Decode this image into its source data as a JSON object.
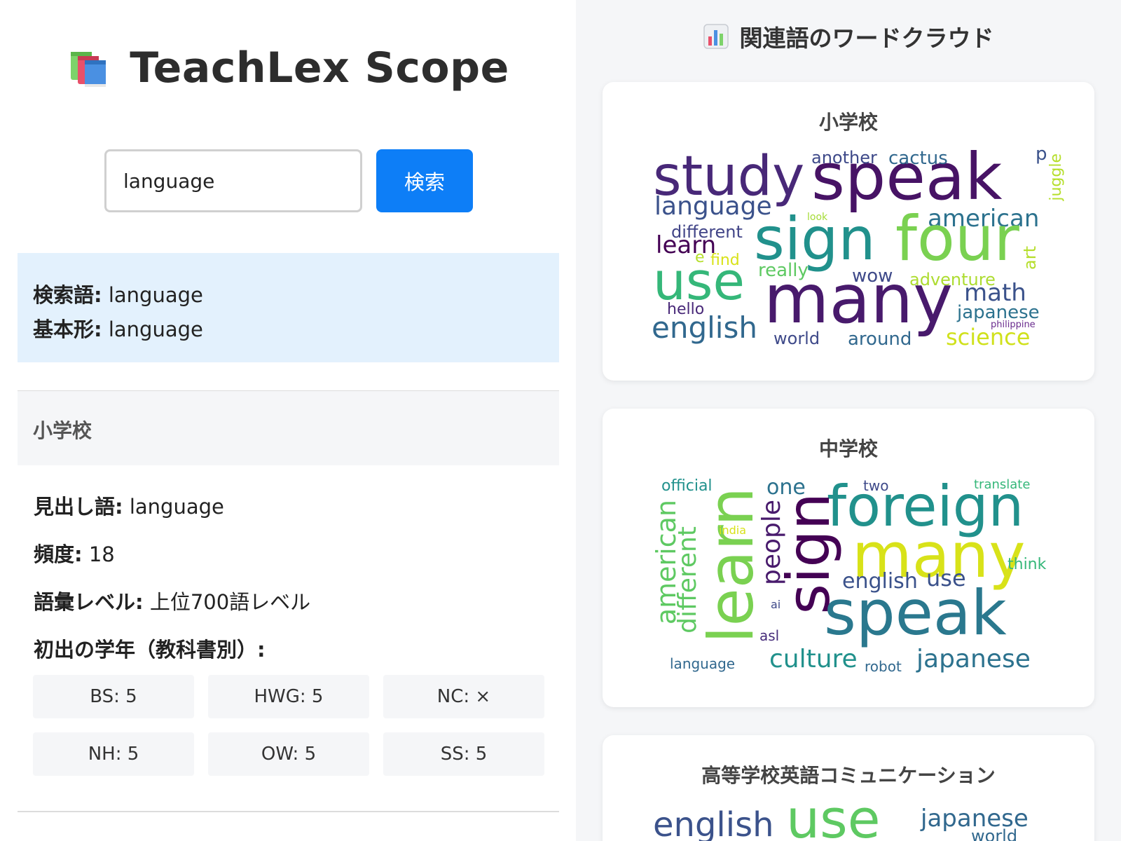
{
  "app": {
    "title": "TeachLex Scope",
    "logo_icon": "books-icon"
  },
  "search": {
    "value": "language",
    "button_label": "検索",
    "button_color": "#0d7ef7"
  },
  "result": {
    "query_label": "検索語:",
    "query_value": " language",
    "base_label": "基本形:",
    "base_value": " language"
  },
  "section": {
    "title": "小学校",
    "headword_label": "見出し語:",
    "headword_value": " language",
    "freq_label": "頻度:",
    "freq_value": " 18",
    "level_label": "語彙レベル:",
    "level_value": " 上位700語レベル",
    "first_grade_label": "初出の学年（教科書別）:",
    "grades": [
      "BS: 5",
      "HWG: 5",
      "NC: ×",
      "NH: 5",
      "OW: 5",
      "SS: 5"
    ]
  },
  "wordcloud": {
    "heading": "関連語のワードクラウド",
    "heading_icon": "bar-chart-icon",
    "cards": [
      {
        "title": "小学校",
        "words": [
          "study",
          "speak",
          "another",
          "cactus",
          "p",
          "juggle",
          "language",
          "american",
          "look",
          "different",
          "learn",
          "sign",
          "four",
          "e",
          "find",
          "art",
          "really",
          "wow",
          "adventure",
          "use",
          "math",
          "hello",
          "many",
          "japanese",
          "english",
          "philippine",
          "world",
          "around",
          "science"
        ]
      },
      {
        "title": "中学校",
        "words": [
          "official",
          "one",
          "two",
          "translate",
          "foreign",
          "american",
          "learn",
          "india",
          "people",
          "sign",
          "many",
          "different",
          "think",
          "english",
          "use",
          "ai",
          "speak",
          "asl",
          "language",
          "culture",
          "robot",
          "japanese"
        ]
      },
      {
        "title": "高等学校英語コミュニケーション",
        "words": [
          "english",
          "use",
          "japanese",
          "world"
        ]
      }
    ]
  }
}
